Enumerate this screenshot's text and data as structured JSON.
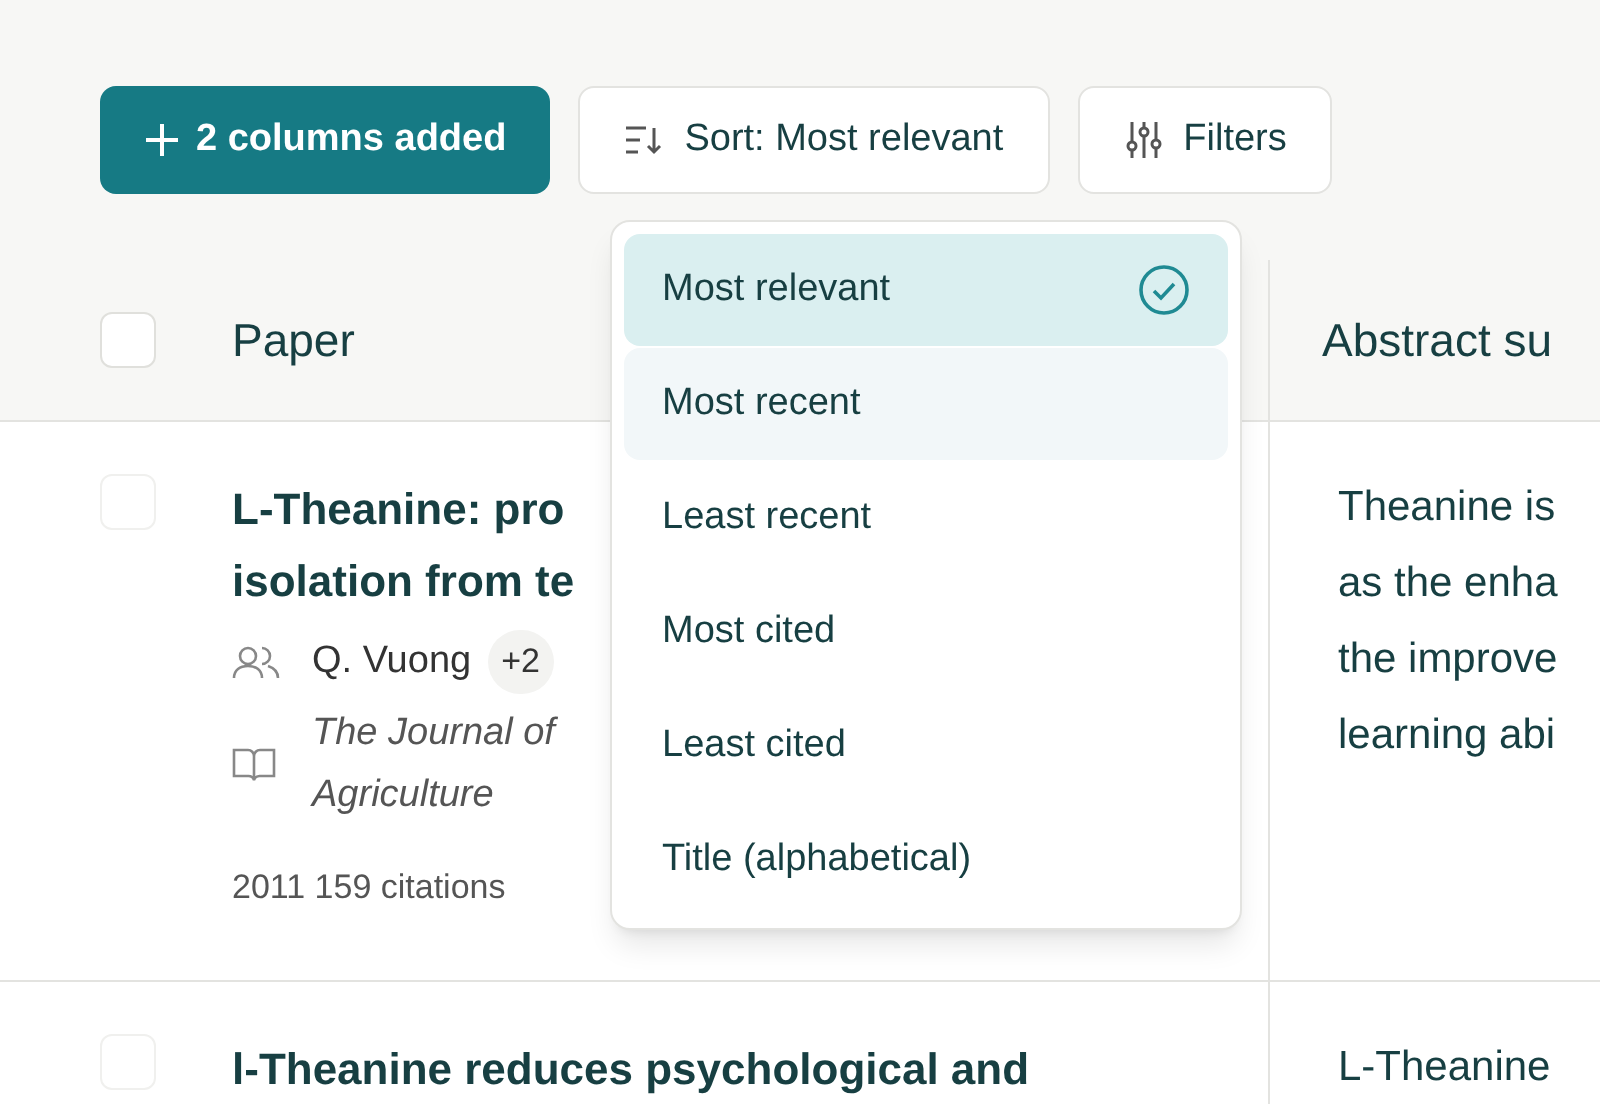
{
  "toolbar": {
    "columns_button": "2 columns added",
    "sort_button": "Sort: Most relevant",
    "filters_button": "Filters"
  },
  "sort_menu": [
    {
      "label": "Most relevant",
      "selected": true,
      "hovered": false
    },
    {
      "label": "Most recent",
      "selected": false,
      "hovered": true
    },
    {
      "label": "Least recent",
      "selected": false,
      "hovered": false
    },
    {
      "label": "Most cited",
      "selected": false,
      "hovered": false
    },
    {
      "label": "Least cited",
      "selected": false,
      "hovered": false
    },
    {
      "label": "Title (alphabetical)",
      "selected": false,
      "hovered": false
    }
  ],
  "table": {
    "select_all_checked": false,
    "columns": [
      "Paper",
      "Abstract su"
    ],
    "rows": [
      {
        "checked": false,
        "title_lines": [
          "L-Theanine: pro",
          "isolation from te"
        ],
        "author": "Q. Vuong",
        "more_authors": "+2",
        "journal_lines": [
          "The Journal of",
          "Agriculture"
        ],
        "meta": "2011 159 citations",
        "abstract_lines": [
          "Theanine is",
          "as the enha",
          "the improve",
          "learning abi"
        ]
      },
      {
        "checked": false,
        "title_lines": [
          "l-Theanine reduces psychological and"
        ],
        "abstract_lines": [
          "L-Theanine"
        ]
      }
    ]
  }
}
